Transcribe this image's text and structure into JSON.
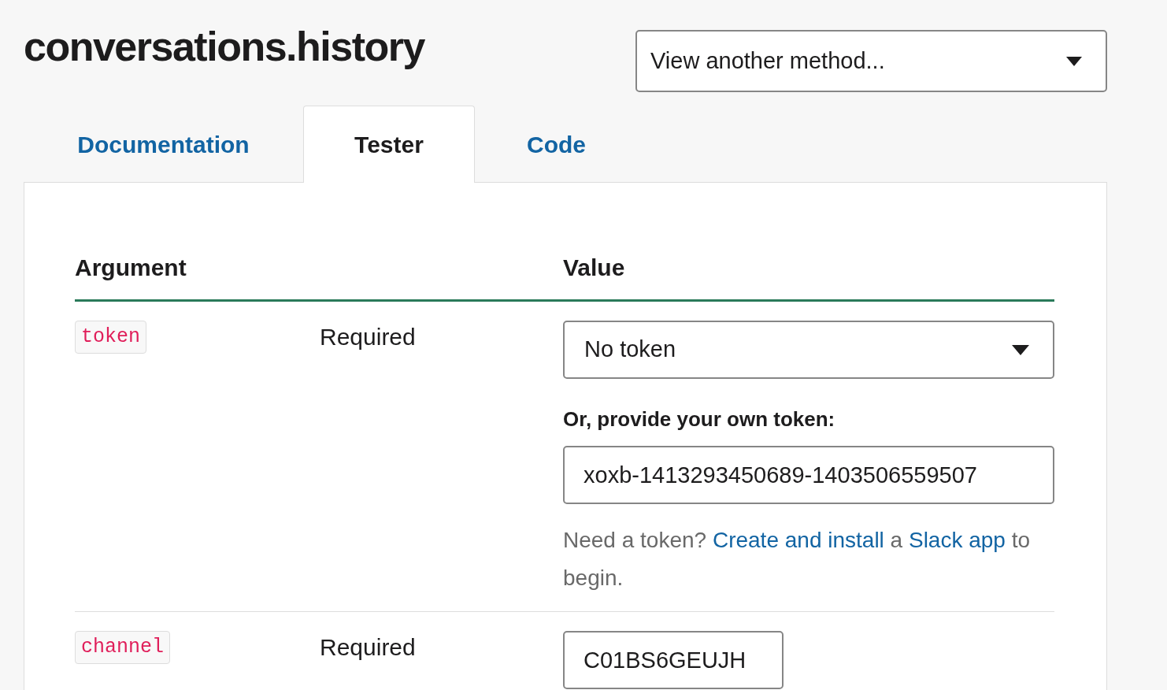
{
  "title": "conversations.history",
  "method_select": {
    "value": "View another method..."
  },
  "tabs": [
    {
      "label": "Documentation",
      "selected": false
    },
    {
      "label": "Tester",
      "selected": true
    },
    {
      "label": "Code",
      "selected": false
    }
  ],
  "table": {
    "columns": [
      "Argument",
      "Value"
    ],
    "rows": [
      {
        "name": "token",
        "requirement": "Required",
        "select_value": "No token",
        "field_label": "Or, provide your own token:",
        "field_value": "xoxb-1413293450689-1403506559507",
        "help": [
          {
            "kind": "text",
            "text": "Need a token?"
          },
          {
            "kind": "link",
            "text": "Create and install"
          },
          {
            "kind": "text",
            "text": "a"
          },
          {
            "kind": "link",
            "text": "Slack app"
          },
          {
            "kind": "text",
            "text": "to begin."
          }
        ]
      },
      {
        "name": "channel",
        "requirement": "Required",
        "field_value": "C01BS6GEUJH"
      }
    ]
  }
}
